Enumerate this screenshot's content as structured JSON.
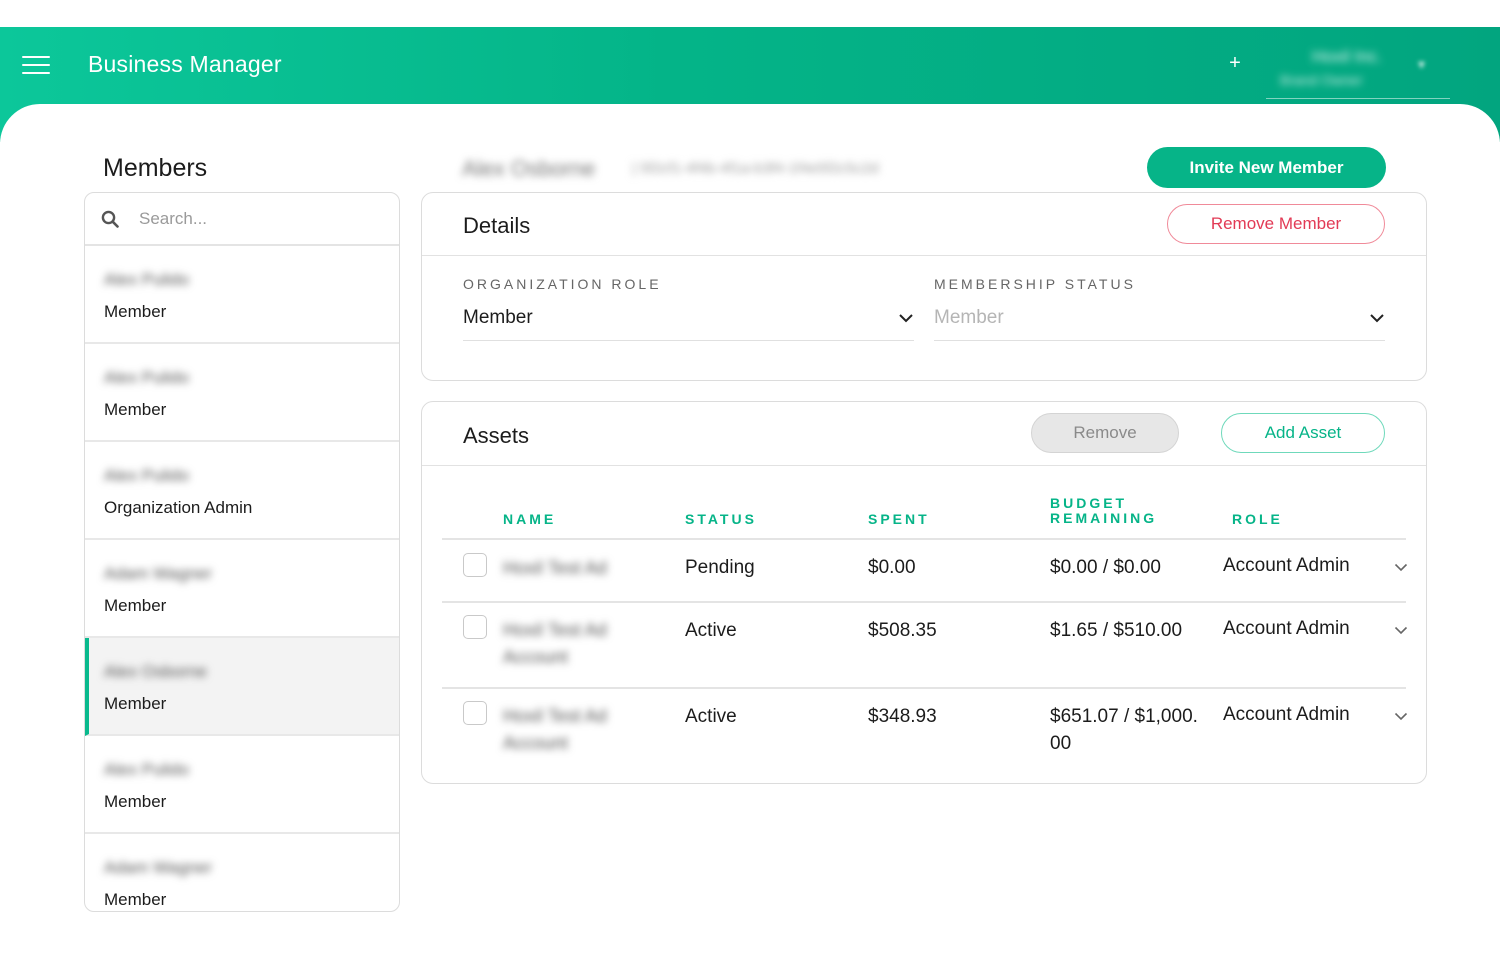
{
  "header": {
    "app_title": "Business Manager",
    "add_label": "+",
    "org_name": "Hoxil Inc.",
    "org_sub": "Brand Owner",
    "org_caret": "▾"
  },
  "sidebar": {
    "title": "Members",
    "search_placeholder": "Search...",
    "members": [
      {
        "name": "Alex Pulido",
        "role": "Member"
      },
      {
        "name": "Alex Pulido",
        "role": "Member"
      },
      {
        "name": "Alex Pulido",
        "role": "Organization Admin"
      },
      {
        "name": "Adam Wagner",
        "role": "Member"
      },
      {
        "name": "Alex Osborne",
        "role": "Member"
      },
      {
        "name": "Alex Pulido",
        "role": "Member"
      },
      {
        "name": "Adam Wagner",
        "role": "Member"
      }
    ]
  },
  "main": {
    "breadcrumb_name": "Alex Osborne",
    "breadcrumb_id": "| 5f2cf1-4f4b-4f1a-b3f4-1f4e5f2c5c2d",
    "invite_label": "Invite New Member",
    "details": {
      "title": "Details",
      "remove_member_label": "Remove Member",
      "org_role_label": "ORGANIZATION ROLE",
      "org_role_value": "Member",
      "membership_status_label": "MEMBERSHIP STATUS",
      "membership_status_value": "Member"
    },
    "assets": {
      "title": "Assets",
      "remove_label": "Remove",
      "add_label": "Add Asset",
      "columns": {
        "name": "NAME",
        "status": "STATUS",
        "spent": "SPENT",
        "budget_line1": "BUDGET",
        "budget_line2": "REMAINING",
        "role": "ROLE"
      },
      "rows": [
        {
          "name": "Hoxil Test Ad",
          "status": "Pending",
          "spent": "$0.00",
          "budget": "$0.00 / $0.00",
          "role": "Account Admin"
        },
        {
          "name": "Hoxil Test Ad Account",
          "status": "Active",
          "spent": "$508.35",
          "budget": "$1.65 / $510.00",
          "role": "Account Admin"
        },
        {
          "name": "Hoxil Test Ad Account",
          "status": "Active",
          "spent": "$348.93",
          "budget": "$651.07 / $1,000.00",
          "role": "Account Admin"
        }
      ]
    }
  },
  "colors": {
    "accent": "#06b488",
    "danger": "#e23a55",
    "selected_bar": "#09b98d"
  }
}
